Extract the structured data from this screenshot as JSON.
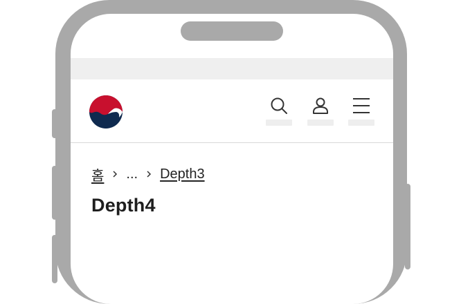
{
  "header": {
    "logo_icon": "korea-government-emblem",
    "actions": [
      {
        "icon": "search-icon"
      },
      {
        "icon": "user-icon"
      },
      {
        "icon": "menu-icon"
      }
    ]
  },
  "breadcrumb": {
    "home_label": "홈",
    "ellipsis_label": "...",
    "current_label": "Depth3"
  },
  "page": {
    "title": "Depth4"
  },
  "colors": {
    "frame": "#a9a9a9",
    "emblem_red": "#c8102e",
    "emblem_blue": "#0f2a4f"
  }
}
